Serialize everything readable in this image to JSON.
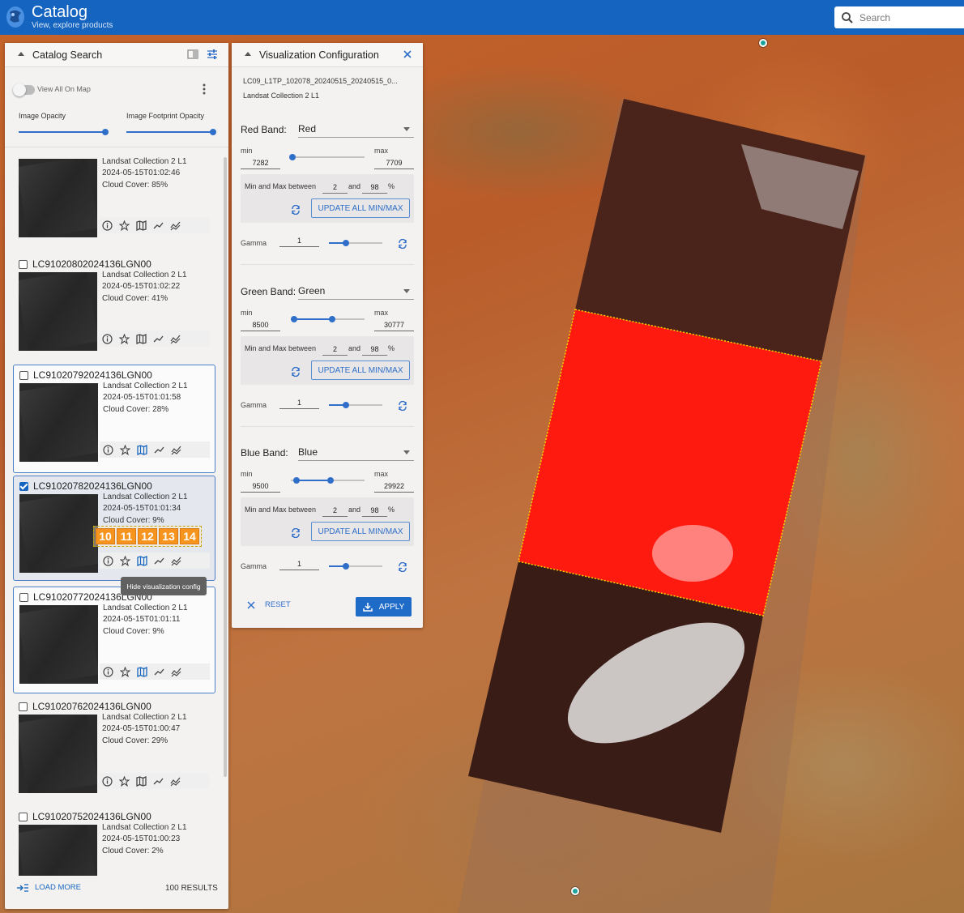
{
  "header": {
    "title": "Catalog",
    "subtitle": "View, explore products",
    "search_placeholder": "Search"
  },
  "catalog": {
    "title": "Catalog Search",
    "view_all_label": "View All On Map",
    "image_opacity_label": "Image Opacity",
    "image_opacity": 1.0,
    "footprint_opacity_label": "Image Footprint Opacity",
    "footprint_opacity": 1.0,
    "results": [
      {
        "id": "",
        "collection": "Landsat Collection 2 L1",
        "date": "2024-05-15T01:02:46",
        "cloud": "Cloud Cover: 85%",
        "checked": false,
        "framed": false,
        "selected": false
      },
      {
        "id": "LC91020802024136LGN00",
        "collection": "Landsat Collection 2 L1",
        "date": "2024-05-15T01:02:22",
        "cloud": "Cloud Cover: 41%",
        "checked": false,
        "framed": false,
        "selected": false
      },
      {
        "id": "LC91020792024136LGN00",
        "collection": "Landsat Collection 2 L1",
        "date": "2024-05-15T01:01:58",
        "cloud": "Cloud Cover: 28%",
        "checked": false,
        "framed": true,
        "selected": false
      },
      {
        "id": "LC91020782024136LGN00",
        "collection": "Landsat Collection 2 L1",
        "date": "2024-05-15T01:01:34",
        "cloud": "Cloud Cover: 9%",
        "checked": true,
        "framed": true,
        "selected": true
      },
      {
        "id": "LC91020772024136LGN00",
        "collection": "Landsat Collection 2 L1",
        "date": "2024-05-15T01:01:11",
        "cloud": "Cloud Cover: 9%",
        "checked": false,
        "framed": true,
        "selected": false
      },
      {
        "id": "LC91020762024136LGN00",
        "collection": "Landsat Collection 2 L1",
        "date": "2024-05-15T01:00:47",
        "cloud": "Cloud Cover: 29%",
        "checked": false,
        "framed": false,
        "selected": false
      },
      {
        "id": "LC91020752024136LGN00",
        "collection": "Landsat Collection 2 L1",
        "date": "2024-05-15T01:00:23",
        "cloud": "Cloud Cover: 2%",
        "checked": false,
        "framed": false,
        "selected": false
      }
    ],
    "load_more_label": "LOAD MORE",
    "result_count": "100 RESULTS",
    "hotkeys": [
      "10",
      "11",
      "12",
      "13",
      "14"
    ],
    "tooltip": "Hide visualization config"
  },
  "viz": {
    "title": "Visualization Configuration",
    "product_id": "LC09_L1TP_102078_20240515_20240515_0...",
    "collection": "Landsat Collection 2 L1",
    "min_label": "min",
    "max_label": "max",
    "pct_label": "Min and Max between",
    "and_label": "and",
    "percent_sign": "%",
    "update_label": "UPDATE ALL MIN/MAX",
    "gamma_label": "Gamma",
    "bands": [
      {
        "title": "Red Band:",
        "value": "Red",
        "min": "7282",
        "max": "7709",
        "low_pct": "2",
        "high_pct": "98",
        "gamma": "1"
      },
      {
        "title": "Green Band:",
        "value": "Green",
        "min": "8500",
        "max": "30777",
        "low_pct": "2",
        "high_pct": "98",
        "gamma": "1"
      },
      {
        "title": "Blue Band:",
        "value": "Blue",
        "min": "9500",
        "max": "29922",
        "low_pct": "2",
        "high_pct": "98",
        "gamma": "1"
      }
    ],
    "reset_label": "RESET",
    "apply_label": "APPLY"
  },
  "colors": {
    "header": "#1565c0",
    "accent": "#2f6fca",
    "highlight_footprint": "#ff1a10",
    "hotkey": "#f7941d"
  }
}
